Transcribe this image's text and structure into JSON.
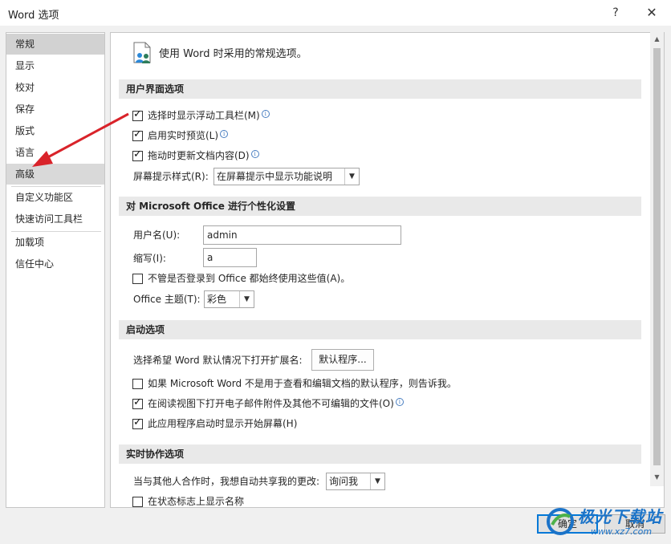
{
  "window": {
    "title": "Word 选项",
    "help_glyph": "?",
    "close_glyph": "✕"
  },
  "sidebar": {
    "items": [
      {
        "label": "常规",
        "active": true
      },
      {
        "label": "显示"
      },
      {
        "label": "校对"
      },
      {
        "label": "保存"
      },
      {
        "label": "版式"
      },
      {
        "label": "语言"
      },
      {
        "label": "高级",
        "hover": true
      },
      {
        "label": "自定义功能区"
      },
      {
        "label": "快速访问工具栏"
      },
      {
        "label": "加载项"
      },
      {
        "label": "信任中心"
      }
    ]
  },
  "main": {
    "header": "使用 Word 时采用的常规选项。",
    "sections": {
      "ui": {
        "title": "用户界面选项",
        "show_minitoolbar": {
          "label": "选择时显示浮动工具栏(M)",
          "checked": true
        },
        "live_preview": {
          "label": "启用实时预览(L)",
          "checked": true
        },
        "update_on_drag": {
          "label": "拖动时更新文档内容(D)",
          "checked": true
        },
        "screentip_label": "屏幕提示样式(R):",
        "screentip_value": "在屏幕提示中显示功能说明"
      },
      "personalize": {
        "title": "对 Microsoft Office 进行个性化设置",
        "username_label": "用户名(U):",
        "username_value": "admin",
        "initials_label": "缩写(I):",
        "initials_value": "a",
        "always_use": {
          "label": "不管是否登录到 Office 都始终使用这些值(A)。",
          "checked": false
        },
        "theme_label": "Office 主题(T):",
        "theme_value": "彩色"
      },
      "startup": {
        "title": "启动选项",
        "extensions_label": "选择希望 Word 默认情况下打开扩展名:",
        "default_programs_button": "默认程序...",
        "tell_me_default": {
          "label": "如果 Microsoft Word 不是用于查看和编辑文档的默认程序，则告诉我。",
          "checked": false
        },
        "open_attachments": {
          "label": "在阅读视图下打开电子邮件附件及其他不可编辑的文件(O)",
          "checked": true
        },
        "show_start_screen": {
          "label": "此应用程序启动时显示开始屏幕(H)",
          "checked": true
        }
      },
      "collab": {
        "title": "实时协作选项",
        "share_changes_label": "当与其他人合作时，我想自动共享我的更改:",
        "share_changes_value": "询问我",
        "show_names": {
          "label": "在状态标志上显示名称",
          "checked": false
        }
      }
    }
  },
  "footer": {
    "ok": "确定",
    "cancel": "取消"
  },
  "watermark": {
    "name": "极光下载站",
    "url": "www.xz7.com"
  },
  "annotation": {
    "arrow_color": "#d9232a"
  }
}
